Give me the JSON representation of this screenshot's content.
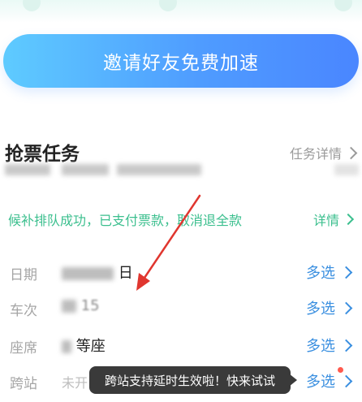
{
  "invite": {
    "label": "邀请好友免费加速"
  },
  "task": {
    "title": "抢票任务",
    "detail_link": "任务详情"
  },
  "status": {
    "text": "候补排队成功，已支付票款，取消退全款",
    "detail_link": "详情"
  },
  "rows": [
    {
      "label": "日期",
      "value": "日",
      "value_prefix": "",
      "choose": "多选"
    },
    {
      "label": "车次",
      "value": "15",
      "choose": "多选"
    },
    {
      "label": "座席",
      "value": "等座",
      "choose": "多选"
    },
    {
      "label": "跨站",
      "value": "未开",
      "choose": "多选"
    }
  ],
  "tooltip": {
    "text": "跨站支持延时生效啦！快来试试"
  },
  "colors": {
    "accent": "#3a8fe0",
    "success": "#3bbf8e",
    "cta_start": "#5ecbff",
    "cta_end": "#4a86ff",
    "arrow": "#e0362f"
  }
}
